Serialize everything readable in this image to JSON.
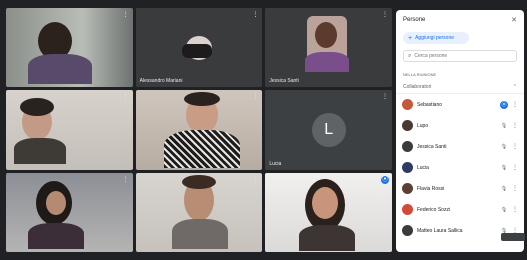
{
  "window": {
    "title": ""
  },
  "panel": {
    "title": "Persone",
    "add_people_label": "Aggiungi persone",
    "search_placeholder": "Cerca persone",
    "section_label": "NELLA RIUNIONE",
    "contributors_label": "Collaboratori",
    "people": [
      {
        "name": "Sebastiano",
        "avatar_color": "#c5573b",
        "mic": "active"
      },
      {
        "name": "Lupo",
        "avatar_color": "#4a3a34",
        "mic": "normal"
      },
      {
        "name": "Jessica Santi",
        "avatar_color": "#3d3b3a",
        "mic": "normal"
      },
      {
        "name": "Lucia",
        "avatar_color": "#2f3b63",
        "mic": "normal"
      },
      {
        "name": "Flavia Rossi",
        "avatar_color": "#5c4036",
        "mic": "normal"
      },
      {
        "name": "Federico Sozzi",
        "avatar_color": "#d44a3a",
        "mic": "normal"
      },
      {
        "name": "Matteo Laura Sallica",
        "avatar_color": "#3b3b3b",
        "mic": "normal"
      }
    ]
  },
  "tiles": [
    {
      "name": "",
      "mic": "normal"
    },
    {
      "name": "Alessandro Mariani",
      "mic": "normal"
    },
    {
      "name": "Jessica Santi",
      "mic": "normal"
    },
    {
      "name": "",
      "mic": "normal"
    },
    {
      "name": "",
      "mic": "normal"
    },
    {
      "name": "Lucia",
      "mic": "normal",
      "avatar_initial": "L"
    },
    {
      "name": "",
      "mic": "normal"
    },
    {
      "name": "",
      "mic": "normal"
    },
    {
      "name": "",
      "mic": "active"
    }
  ]
}
